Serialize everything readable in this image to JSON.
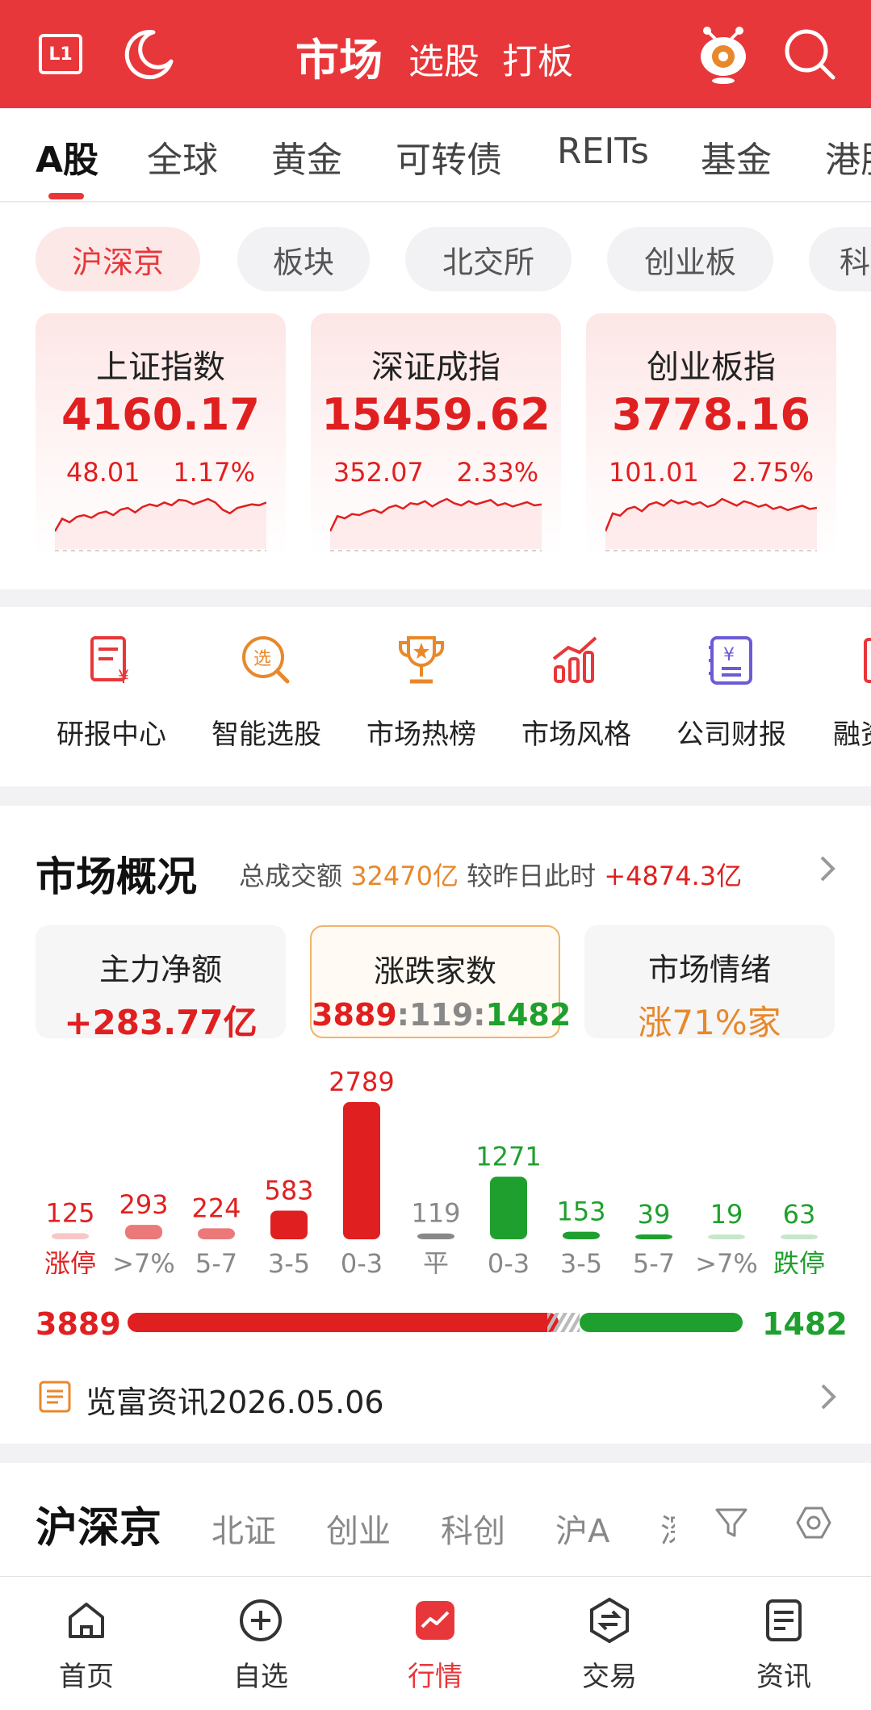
{
  "header": {
    "l1_label": "L1",
    "title": "市场",
    "sub1": "选股",
    "sub2": "打板"
  },
  "market_tabs": [
    "A股",
    "全球",
    "黄金",
    "可转债",
    "REITs",
    "基金",
    "港股"
  ],
  "sub_tabs": [
    "沪深京",
    "板块",
    "北交所",
    "创业板",
    "科创板"
  ],
  "indices": [
    {
      "name": "上证指数",
      "price": "4160.17",
      "change": "48.01",
      "pct": "1.17%",
      "spark": [
        20,
        34,
        30,
        36,
        38,
        35,
        40,
        42,
        38,
        44,
        46,
        41,
        47,
        50,
        48,
        52,
        49,
        55,
        54,
        50,
        53,
        56,
        52,
        44,
        40,
        46,
        48,
        50,
        49,
        52
      ]
    },
    {
      "name": "深证成指",
      "price": "15459.62",
      "change": "352.07",
      "pct": "2.33%",
      "spark": [
        22,
        36,
        34,
        38,
        37,
        40,
        42,
        39,
        44,
        46,
        43,
        48,
        47,
        50,
        45,
        49,
        52,
        48,
        46,
        50,
        47,
        49,
        51,
        46,
        48,
        45,
        47,
        49,
        46,
        47
      ]
    },
    {
      "name": "创业板指",
      "price": "3778.16",
      "change": "101.01",
      "pct": "2.75%",
      "spark": [
        24,
        40,
        38,
        44,
        46,
        42,
        48,
        50,
        47,
        52,
        49,
        51,
        48,
        50,
        46,
        48,
        53,
        50,
        47,
        51,
        49,
        46,
        48,
        44,
        46,
        43,
        45,
        47,
        44,
        45
      ]
    }
  ],
  "functions": [
    "研报中心",
    "智能选股",
    "市场热榜",
    "市场风格",
    "公司财报",
    "融资融券"
  ],
  "overview": {
    "title": "市场概况",
    "turnover_label": "总成交额",
    "turnover_value": "32470亿",
    "compare_label": "较昨日此时",
    "compare_value": "+4874.3亿",
    "stats": [
      {
        "title": "主力净额",
        "value": "+283.77亿"
      },
      {
        "title": "涨跌家数",
        "up": "3889",
        "flat": "119",
        "down": "1482"
      },
      {
        "title": "市场情绪",
        "value": "涨71%家"
      }
    ],
    "up_total": "3889",
    "down_total": "1482",
    "news": "览富资讯2026.05.06"
  },
  "chart_data": {
    "type": "bar",
    "title": "",
    "categories": [
      "涨停",
      ">7%",
      "5-7",
      "3-5",
      "0-3",
      "平",
      "0-3",
      "3-5",
      "5-7",
      ">7%",
      "跌停"
    ],
    "values": [
      125,
      293,
      224,
      583,
      2789,
      119,
      1271,
      153,
      39,
      19,
      63
    ],
    "colors": [
      "#e02020",
      "#e02020",
      "#e02020",
      "#e02020",
      "#e02020",
      "#888888",
      "#1fa02e",
      "#1fa02e",
      "#1fa02e",
      "#1fa02e",
      "#1fa02e"
    ],
    "xlabel": "",
    "ylabel": ""
  },
  "list_tabs": {
    "main": "沪深京",
    "items": [
      "北证",
      "创业",
      "科创",
      "沪A",
      "深A"
    ]
  },
  "bottom_nav": [
    "首页",
    "自选",
    "行情",
    "交易",
    "资讯"
  ],
  "colors": {
    "brand": "#e8373a",
    "up": "#e02020",
    "down": "#1fa02e",
    "accent": "#e8882b"
  }
}
